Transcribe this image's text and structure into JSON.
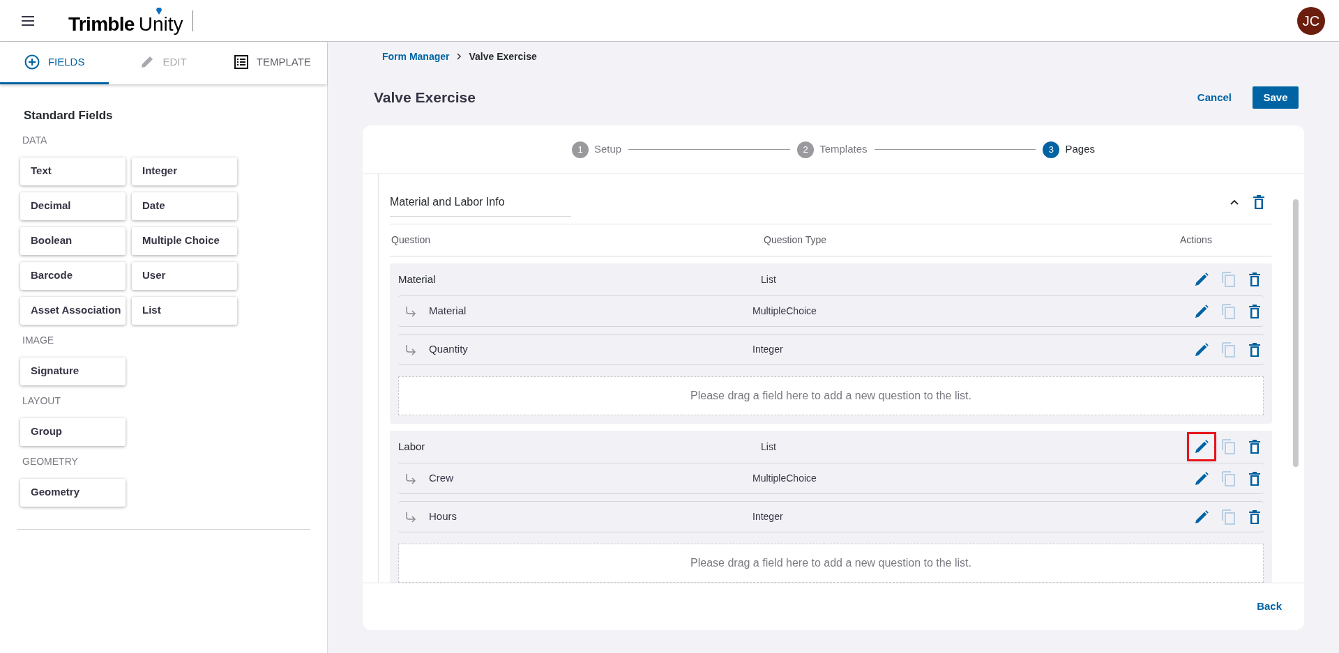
{
  "header": {
    "logo": {
      "brand": "Trimble",
      "product": "Unity"
    },
    "avatar": "JC"
  },
  "sidebar": {
    "tabs": [
      {
        "label": "FIELDS",
        "kind": "add",
        "selected": true,
        "disabled": false
      },
      {
        "label": "EDIT",
        "kind": "edit",
        "selected": false,
        "disabled": true
      },
      {
        "label": "TEMPLATE",
        "kind": "template",
        "selected": false,
        "disabled": false
      }
    ],
    "heading": "Standard Fields",
    "groups": [
      {
        "label": "DATA",
        "fields": [
          "Text",
          "Integer",
          "Decimal",
          "Date",
          "Boolean",
          "Multiple Choice",
          "Barcode",
          "User",
          "Asset Association",
          "List"
        ]
      },
      {
        "label": "IMAGE",
        "fields": [
          "Signature"
        ]
      },
      {
        "label": "LAYOUT",
        "fields": [
          "Group"
        ]
      },
      {
        "label": "GEOMETRY",
        "fields": [
          "Geometry"
        ]
      }
    ]
  },
  "breadcrumb": [
    {
      "label": "Form Manager",
      "kind": "link"
    },
    {
      "label": "Valve Exercise",
      "kind": "current"
    }
  ],
  "title": "Valve Exercise",
  "actions": {
    "cancel": "Cancel",
    "save": "Save"
  },
  "stepper": [
    {
      "number": "1",
      "label": "Setup",
      "selected": false
    },
    {
      "number": "2",
      "label": "Templates",
      "selected": false
    },
    {
      "number": "3",
      "label": "Pages",
      "selected": true
    }
  ],
  "page": {
    "title": "Material and Labor Info",
    "expanded": true,
    "columns": [
      "Question",
      "Question Type",
      "Actions"
    ],
    "lists": [
      {
        "question": "Material",
        "type": "List",
        "highlighted": false,
        "children": [
          {
            "question": "Material",
            "type": "MultipleChoice"
          },
          {
            "question": "Quantity",
            "type": "Integer"
          }
        ],
        "drop_hint": "Please drag a field here to add a new question to the list."
      },
      {
        "question": "Labor",
        "type": "List",
        "highlighted": true,
        "children": [
          {
            "question": "Crew",
            "type": "MultipleChoice"
          },
          {
            "question": "Hours",
            "type": "Integer"
          }
        ],
        "drop_hint": "Please drag a field here to add a new question to the list."
      }
    ]
  },
  "footer": {
    "back": "Back"
  }
}
